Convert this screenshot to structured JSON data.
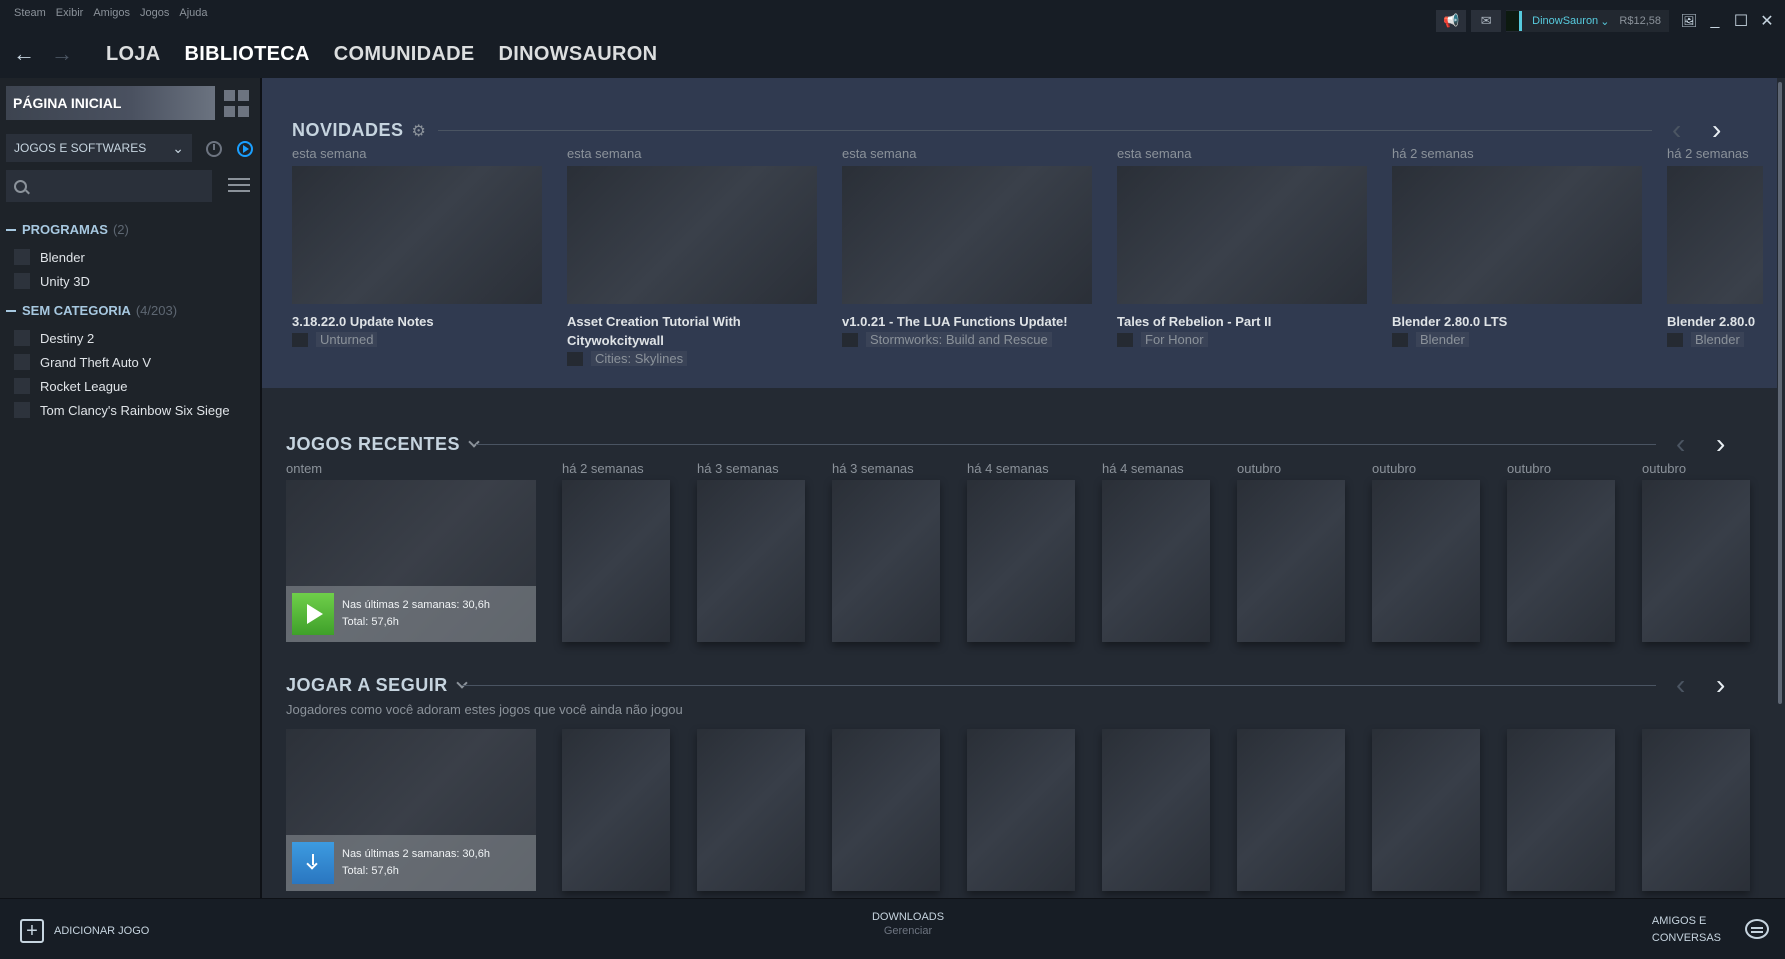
{
  "menu": [
    "Steam",
    "Exibir",
    "Amigos",
    "Jogos",
    "Ajuda"
  ],
  "titlebar": {
    "username": "DinowSauron",
    "wallet": "R$12,58"
  },
  "nav": {
    "links": [
      "LOJA",
      "BIBLIOTECA",
      "COMUNIDADE",
      "DINOWSAURON"
    ]
  },
  "sidebar": {
    "home_label": "PÁGINA INICIAL",
    "filter_label": "JOGOS E SOFTWARES",
    "search_placeholder": "",
    "categories": [
      {
        "name": "PROGRAMAS",
        "count": "(2)",
        "items": [
          "Blender",
          "Unity 3D"
        ]
      },
      {
        "name": "SEM CATEGORIA",
        "count": "(4/203)",
        "items": [
          "Destiny 2",
          "Grand Theft Auto V",
          "Rocket League",
          "Tom Clancy's Rainbow Six Siege"
        ]
      }
    ]
  },
  "news": {
    "title": "NOVIDADES",
    "cards": [
      {
        "when": "esta semana",
        "title": "3.18.22.0 Update Notes",
        "game": "Unturned"
      },
      {
        "when": "esta semana",
        "title": "Asset Creation Tutorial With Citywokcitywall",
        "game": "Cities: Skylines"
      },
      {
        "when": "esta semana",
        "title": "v1.0.21 - The LUA Functions Update!",
        "game": "Stormworks: Build and Rescue"
      },
      {
        "when": "esta semana",
        "title": "Tales of Rebelion - Part II",
        "game": "For Honor"
      },
      {
        "when": "há 2 semanas",
        "title": "Blender 2.80.0 LTS",
        "game": "Blender"
      },
      {
        "when": "há 2 semanas",
        "title": "Blender 2.80.0",
        "game": "Blender"
      }
    ]
  },
  "recent": {
    "title": "JOGOS RECENTES",
    "when": [
      "ontem",
      "há 2 semanas",
      "há 3 semanas",
      "há 3 semanas",
      "há 4 semanas",
      "há 4 semanas",
      "outubro",
      "outubro",
      "outubro",
      "outubro"
    ],
    "play_line1": "Nas últimas 2 samanas: 30,6h",
    "play_line2": "Total: 57,6h"
  },
  "next": {
    "title": "JOGAR A SEGUIR",
    "subtitle": "Jogadores como você adoram estes jogos que você ainda não jogou",
    "play_line1": "Nas últimas 2 samanas: 30,6h",
    "play_line2": "Total: 57,6h"
  },
  "bottom": {
    "add_game": "ADICIONAR JOGO",
    "downloads": "DOWNLOADS",
    "downloads_sub": "Gerenciar",
    "friends_line1": "AMIGOS E",
    "friends_line2": "CONVERSAS"
  }
}
